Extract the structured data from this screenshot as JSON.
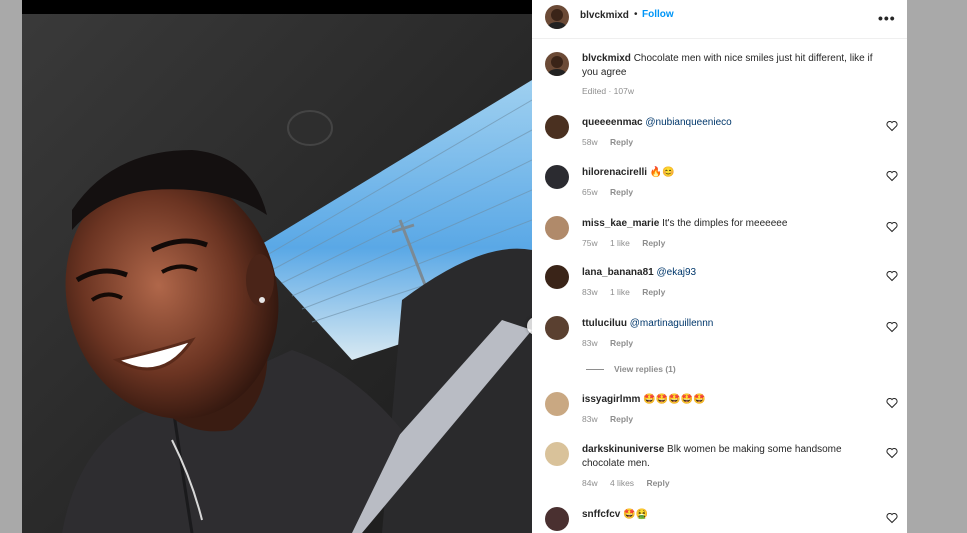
{
  "post": {
    "author": "blvckmixd",
    "follow_label": "Follow",
    "separator": "•",
    "more_icon": "more-horizontal-icon",
    "caption": "Chocolate men with nice smiles just hit different, like if you agree",
    "caption_meta": "Edited · 107w",
    "next_icon": "chevron-right-icon"
  },
  "comments": [
    {
      "user": "queeeenmac",
      "text": "",
      "mention": "@nubianqueenieco",
      "time": "58w",
      "likes": "",
      "reply": "Reply",
      "avatar_color": "#4a3020"
    },
    {
      "user": "hilorenacirelli",
      "text": "🔥😊",
      "mention": "",
      "time": "65w",
      "likes": "",
      "reply": "Reply",
      "avatar_color": "#2b2b30"
    },
    {
      "user": "miss_kae_marie",
      "text": "It's the dimples for meeeeee",
      "mention": "",
      "time": "75w",
      "likes": "1 like",
      "reply": "Reply",
      "avatar_color": "#b08a6a"
    },
    {
      "user": "lana_banana81",
      "text": "",
      "mention": "@ekaj93",
      "time": "83w",
      "likes": "1 like",
      "reply": "Reply",
      "avatar_color": "#3a2418"
    },
    {
      "user": "ttuluciluu",
      "text": "",
      "mention": "@martinaguillennn",
      "time": "83w",
      "likes": "",
      "reply": "Reply",
      "avatar_color": "#5a4030"
    },
    {
      "user": "issyagirlmm",
      "text": "🤩🤩🤩🤩🤩",
      "mention": "",
      "time": "83w",
      "likes": "",
      "reply": "Reply",
      "avatar_color": "#c9a882"
    },
    {
      "user": "darkskinuniverse",
      "text": "Blk women be making some handsome chocolate men.",
      "mention": "",
      "time": "84w",
      "likes": "4 likes",
      "reply": "Reply",
      "avatar_color": "#d9c29a"
    },
    {
      "user": "snffcfcv",
      "text": "🤩🤮",
      "mention": "",
      "time": "",
      "likes": "",
      "reply": "",
      "avatar_color": "#4a3030"
    }
  ],
  "view_replies": "View replies (1)",
  "colors": {
    "link": "#0095f6",
    "mention": "#00376b",
    "meta": "#8e8e8e"
  }
}
